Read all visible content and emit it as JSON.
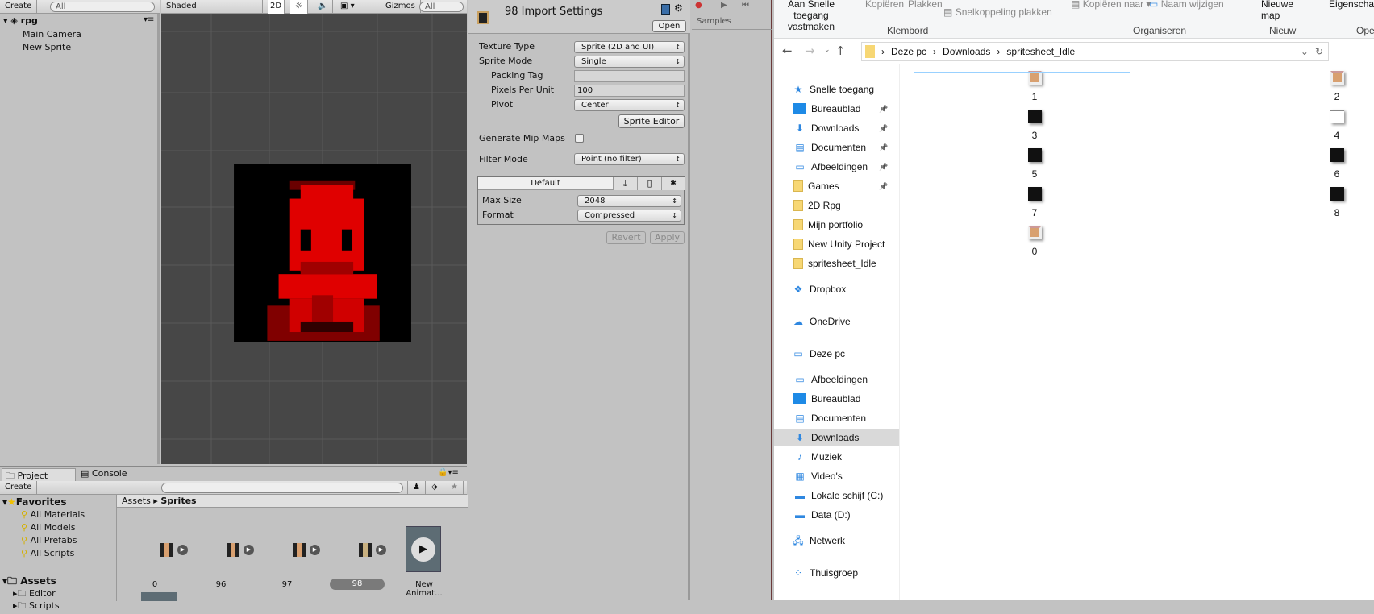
{
  "hierarchy": {
    "create": "Create",
    "search": "All",
    "scene": "rpg",
    "items": [
      "Main Camera",
      "New Sprite"
    ]
  },
  "scene": {
    "shading": "Shaded",
    "mode2d": "2D",
    "gizmos": "Gizmos",
    "search": "All"
  },
  "inspector": {
    "title": "98 Import Settings",
    "open": "Open",
    "texture_type_label": "Texture Type",
    "texture_type": "Sprite (2D and UI)",
    "sprite_mode_label": "Sprite Mode",
    "sprite_mode": "Single",
    "packing_tag_label": "Packing Tag",
    "packing_tag": "",
    "ppu_label": "Pixels Per Unit",
    "ppu": "100",
    "pivot_label": "Pivot",
    "pivot": "Center",
    "sprite_editor": "Sprite Editor",
    "mipmaps_label": "Generate Mip Maps",
    "mipmaps": false,
    "filter_label": "Filter Mode",
    "filter": "Point (no filter)",
    "platform_default": "Default",
    "max_size_label": "Max Size",
    "max_size": "2048",
    "format_label": "Format",
    "format": "Compressed",
    "revert": "Revert",
    "apply": "Apply"
  },
  "animation": {
    "samples": "Samples"
  },
  "project": {
    "tabs": [
      "Project",
      "Console"
    ],
    "create": "Create",
    "search": "",
    "favorites": "Favorites",
    "fav_items": [
      "All Materials",
      "All Models",
      "All Prefabs",
      "All Scripts"
    ],
    "assets": "Assets",
    "asset_folders": [
      "Editor",
      "Scripts"
    ],
    "breadcrumb": [
      "Assets",
      "Sprites"
    ],
    "files": [
      "0",
      "96",
      "97",
      "98",
      "New Animat..."
    ],
    "selected": "98"
  },
  "explorer": {
    "ribbon": {
      "pin": "Aan Snelle toegang vastmaken",
      "copy": "Kopiëren",
      "paste": "Plakken",
      "paste_shortcut": "Snelkoppeling plakken",
      "copy_to": "Kopiëren naar",
      "rename": "Naam wijzigen",
      "new_folder": "Nieuwe map",
      "properties": "Eigenschappen",
      "groups": [
        "Klembord",
        "Organiseren",
        "Nieuw",
        "Openen"
      ]
    },
    "path": [
      "Deze pc",
      "Downloads",
      "spritesheet_Idle"
    ],
    "nav": [
      {
        "label": "Snelle toegang",
        "icon": "star-icon",
        "indent": 0
      },
      {
        "label": "Bureaublad",
        "icon": "desktop-icon",
        "indent": 1,
        "pinned": true
      },
      {
        "label": "Downloads",
        "icon": "download-icon",
        "indent": 1,
        "pinned": true
      },
      {
        "label": "Documenten",
        "icon": "document-icon",
        "indent": 1,
        "pinned": true
      },
      {
        "label": "Afbeeldingen",
        "icon": "pictures-icon",
        "indent": 1,
        "pinned": true
      },
      {
        "label": "Games",
        "icon": "folder-icon",
        "indent": 1,
        "pinned": true
      },
      {
        "label": "2D Rpg",
        "icon": "folder-icon",
        "indent": 1
      },
      {
        "label": "Mijn portfolio",
        "icon": "folder-icon",
        "indent": 1
      },
      {
        "label": "New Unity Project",
        "icon": "folder-icon",
        "indent": 1
      },
      {
        "label": "spritesheet_Idle",
        "icon": "folder-icon",
        "indent": 1
      },
      {
        "label": "Dropbox",
        "icon": "dropbox-icon",
        "indent": 0,
        "gap": true
      },
      {
        "label": "OneDrive",
        "icon": "cloud-icon",
        "indent": 0,
        "gap": true
      },
      {
        "label": "Deze pc",
        "icon": "computer-icon",
        "indent": 0,
        "gap": true
      },
      {
        "label": "Afbeeldingen",
        "icon": "pictures-icon",
        "indent": 1
      },
      {
        "label": "Bureaublad",
        "icon": "desktop-icon",
        "indent": 1
      },
      {
        "label": "Documenten",
        "icon": "document-icon",
        "indent": 1
      },
      {
        "label": "Downloads",
        "icon": "download-icon",
        "indent": 1,
        "selected": true
      },
      {
        "label": "Muziek",
        "icon": "music-icon",
        "indent": 1
      },
      {
        "label": "Video's",
        "icon": "video-icon",
        "indent": 1
      },
      {
        "label": "Lokale schijf (C:)",
        "icon": "drive-icon",
        "indent": 1
      },
      {
        "label": "Data (D:)",
        "icon": "drive-icon",
        "indent": 1
      },
      {
        "label": "Netwerk",
        "icon": "network-icon",
        "indent": 0,
        "gap": true
      },
      {
        "label": "Thuisgroep",
        "icon": "homegroup-icon",
        "indent": 0,
        "gap": true
      }
    ],
    "files": [
      {
        "name": "1",
        "thumb": "sprite"
      },
      {
        "name": "2",
        "thumb": "sprite"
      },
      {
        "name": "3",
        "thumb": "black"
      },
      {
        "name": "4",
        "thumb": "white"
      },
      {
        "name": "5",
        "thumb": "black"
      },
      {
        "name": "6",
        "thumb": "black"
      },
      {
        "name": "7",
        "thumb": "black"
      },
      {
        "name": "8",
        "thumb": "black"
      },
      {
        "name": "0",
        "thumb": "sprite"
      }
    ],
    "selected_file": "1"
  },
  "colors": {
    "unity_bg": "#c2c2c2",
    "scene_bg": "#474747",
    "sprite_red": "#e00000",
    "selection_blue": "#99d1ff",
    "nav_selected": "#d9d9d9"
  }
}
